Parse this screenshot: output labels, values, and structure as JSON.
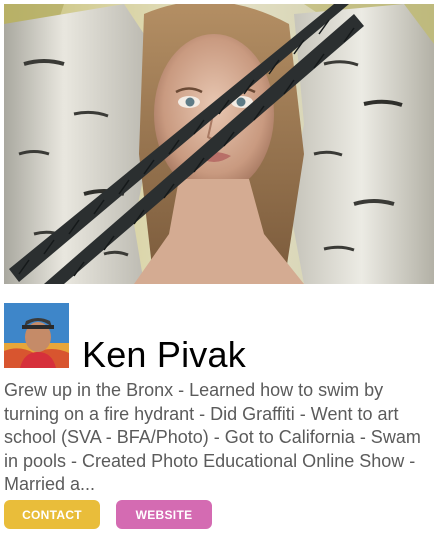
{
  "profile": {
    "name": "Ken Pivak",
    "bio": "Grew up in the Bronx - Learned how to swim by turning on a fire hydrant - Did Graffiti - Went to art school (SVA - BFA/Photo) - Got to California - Swam in pools - Created Photo Educational Online Show - Married a..."
  },
  "actions": {
    "contact_label": "CONTACT",
    "website_label": "WEBSITE"
  },
  "colors": {
    "contact": "#e9bd3a",
    "website": "#d46bb2",
    "name_text": "#000000",
    "bio_text": "#5b5b5b"
  },
  "images": {
    "cover": "cover-photo",
    "avatar": "profile-avatar"
  }
}
